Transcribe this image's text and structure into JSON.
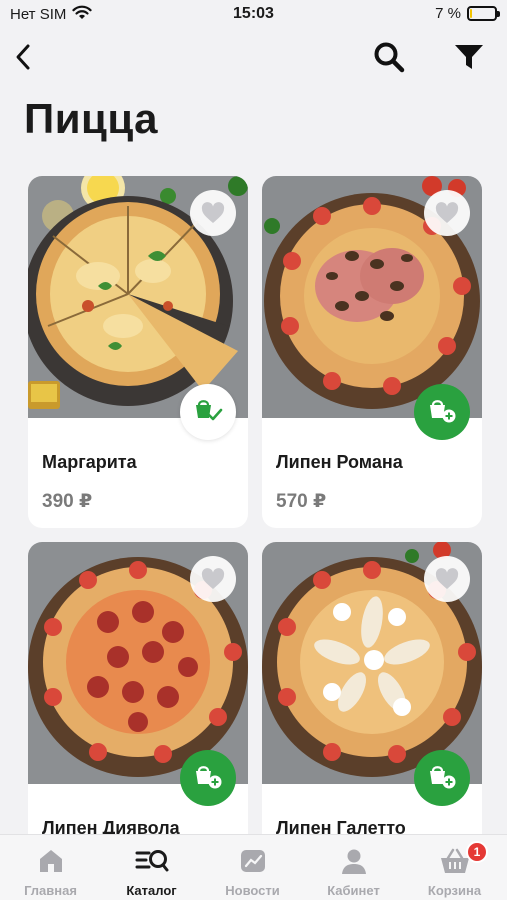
{
  "status_bar": {
    "carrier": "Нет SIM",
    "time": "15:03",
    "battery": "7 %",
    "battery_level": 0.07
  },
  "header": {
    "back_icon": "chevron-left-icon",
    "search_icon": "search-icon",
    "filter_icon": "filter-icon"
  },
  "page": {
    "title": "Пицца"
  },
  "products": [
    {
      "name": "Маргарита",
      "price": "390 ₽",
      "in_cart": true,
      "style": "margherita"
    },
    {
      "name": "Липен Романа",
      "price": "570 ₽",
      "in_cart": false,
      "style": "romana"
    },
    {
      "name": "Липен Диявола",
      "price": "",
      "in_cart": false,
      "style": "diavola"
    },
    {
      "name": "Липен Галетто",
      "price": "",
      "in_cart": false,
      "style": "galetto"
    }
  ],
  "tabbar": {
    "items": [
      {
        "label": "Главная",
        "icon": "home-icon",
        "active": false
      },
      {
        "label": "Каталог",
        "icon": "catalog-icon",
        "active": true
      },
      {
        "label": "Новости",
        "icon": "news-icon",
        "active": false
      },
      {
        "label": "Кабинет",
        "icon": "profile-icon",
        "active": false
      },
      {
        "label": "Корзина",
        "icon": "basket-icon",
        "active": false,
        "badge": "1"
      }
    ]
  },
  "colors": {
    "accent_green": "#2aa13f",
    "badge_red": "#e53935",
    "background": "#f2f2f4"
  }
}
